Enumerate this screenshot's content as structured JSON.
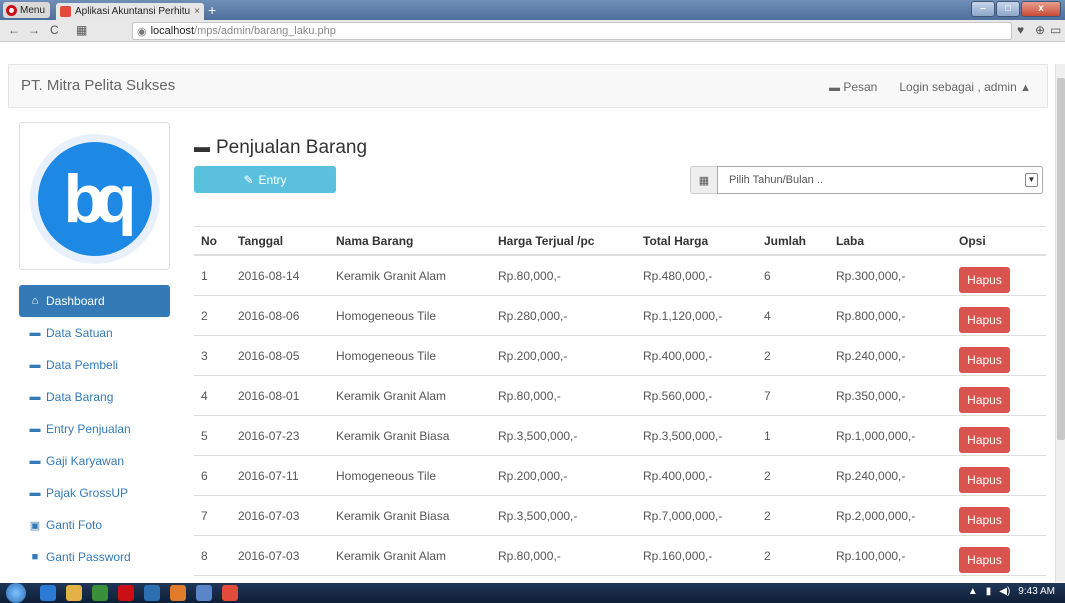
{
  "browser": {
    "menu_label": "Menu",
    "tab_title": "Aplikasi Akuntansi Perhitu",
    "tab_close": "×",
    "new_tab": "+",
    "url_host": "localhost",
    "url_path": "/mps/admin/barang_laku.php"
  },
  "navbar": {
    "brand": "PT. Mitra Pelita Sukses",
    "pesan": "Pesan",
    "login": "Login sebagai , admin"
  },
  "logo": {
    "text": "bq"
  },
  "sidebar": {
    "items": [
      {
        "label": "Dashboard"
      },
      {
        "label": "Data Satuan"
      },
      {
        "label": "Data Pembeli"
      },
      {
        "label": "Data Barang"
      },
      {
        "label": "Entry Penjualan"
      },
      {
        "label": "Gaji Karyawan"
      },
      {
        "label": "Pajak GrossUP"
      },
      {
        "label": "Ganti Foto"
      },
      {
        "label": "Ganti Password"
      }
    ]
  },
  "main": {
    "title": "Penjualan Barang",
    "entry_label": "Entry",
    "select_placeholder": "Pilih Tahun/Bulan ..",
    "columns": [
      "No",
      "Tanggal",
      "Nama Barang",
      "Harga Terjual /pc",
      "Total Harga",
      "Jumlah",
      "Laba",
      "Opsi"
    ],
    "delete_label": "Hapus",
    "rows": [
      {
        "no": "1",
        "tanggal": "2016-08-14",
        "nama": "Keramik Granit Alam",
        "harga": "Rp.80,000,-",
        "total": "Rp.480,000,-",
        "jumlah": "6",
        "laba": "Rp.300,000,-"
      },
      {
        "no": "2",
        "tanggal": "2016-08-06",
        "nama": "Homogeneous Tile",
        "harga": "Rp.280,000,-",
        "total": "Rp.1,120,000,-",
        "jumlah": "4",
        "laba": "Rp.800,000,-"
      },
      {
        "no": "3",
        "tanggal": "2016-08-05",
        "nama": "Homogeneous Tile",
        "harga": "Rp.200,000,-",
        "total": "Rp.400,000,-",
        "jumlah": "2",
        "laba": "Rp.240,000,-"
      },
      {
        "no": "4",
        "tanggal": "2016-08-01",
        "nama": "Keramik Granit Alam",
        "harga": "Rp.80,000,-",
        "total": "Rp.560,000,-",
        "jumlah": "7",
        "laba": "Rp.350,000,-"
      },
      {
        "no": "5",
        "tanggal": "2016-07-23",
        "nama": "Keramik Granit Biasa",
        "harga": "Rp.3,500,000,-",
        "total": "Rp.3,500,000,-",
        "jumlah": "1",
        "laba": "Rp.1,000,000,-"
      },
      {
        "no": "6",
        "tanggal": "2016-07-11",
        "nama": "Homogeneous Tile",
        "harga": "Rp.200,000,-",
        "total": "Rp.400,000,-",
        "jumlah": "2",
        "laba": "Rp.240,000,-"
      },
      {
        "no": "7",
        "tanggal": "2016-07-03",
        "nama": "Keramik Granit Biasa",
        "harga": "Rp.3,500,000,-",
        "total": "Rp.7,000,000,-",
        "jumlah": "2",
        "laba": "Rp.2,000,000,-"
      },
      {
        "no": "8",
        "tanggal": "2016-07-03",
        "nama": "Keramik Granit Alam",
        "harga": "Rp.80,000,-",
        "total": "Rp.160,000,-",
        "jumlah": "2",
        "laba": "Rp.100,000,-"
      }
    ]
  },
  "taskbar": {
    "clock": "9:43 AM"
  },
  "colors": {
    "primary": "#337ab7",
    "info": "#5bc0de",
    "danger": "#d9534f"
  }
}
